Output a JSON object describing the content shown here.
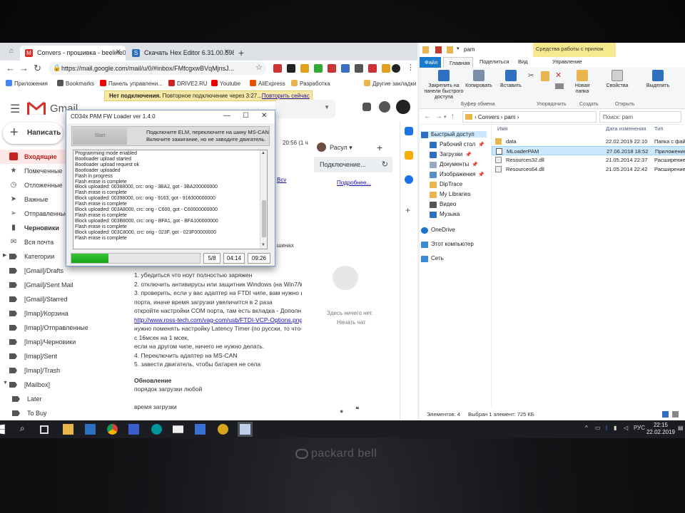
{
  "chrome": {
    "tabs": [
      {
        "title": "Convers - прошивка - beeline09",
        "active": true
      },
      {
        "title": "Скачать Hex Editor 6.31.00.5980",
        "active": false
      }
    ],
    "url": "https://mail.google.com/mail/u/0/#inbox/FMfcgxwBVqMjnsJ...",
    "bookmarks": [
      "Приложения",
      "Bookmarks",
      "Панель управлени...",
      "DRIVE2.RU",
      "Youtube",
      "AliExpress",
      "Разработка",
      "Другие закладки"
    ],
    "banner": {
      "bold": "Нет подключения.",
      "text": " Повторное подключение через 3:27...",
      "link": "Повторить сейчас"
    }
  },
  "gmail": {
    "logo_text": "Gmail",
    "compose": "Написать",
    "sidebar": [
      "Входящие",
      "Помеченные",
      "Отложенные",
      "Важные",
      "Отправленные",
      "Черновики",
      "Вся почта",
      "Категории",
      "[Gmail]/Drafts",
      "[Gmail]/Sent Mail",
      "[Gmail]/Starred",
      "[Imap]/Корзина",
      "[Imap]/Отправленные",
      "[Imap]/Черновики",
      "[Imap]/Sent",
      "[Imap]/Trash",
      "[Mailbox]",
      "Later",
      "To Buy"
    ],
    "fragments": {
      "time": "20:56 (1 ч",
      "link": "Bcv",
      "shinah": "шинах"
    },
    "body": [
      "1. убедиться что ноут полностью заряжен",
      "2. отключить антивирусы или защитник Windows (на Win7/W",
      "3. проверить, если у вас адаптер на FTDI чипе, вам нужно и",
      "порта, иначе время загрузки увеличится в 2 раза",
      "откройте настройки COM порта, там есть вкладка - Дополн",
      "http://www.ross-tech.com/vag-com/usb/FTDI-VCP-Options.png",
      "нужно поменять настройку Latency Timer (по русски, то что-",
      "с 16мсек на 1 мсек,",
      "если на другом чипе, ничего не нужно делать.",
      "4. Переключить адаптер на MS-CAN",
      "5. завести двигатель, чтобы батарея не села"
    ],
    "update_header": "Обновление",
    "update_text": "порядок загрузки любой",
    "load_time": "время загрузки",
    "hangouts": {
      "user": "Расул",
      "connecting": "Подключение...",
      "more": "Подробнее...",
      "empty": "Здесь ничего нет.",
      "start": "Начать чат"
    }
  },
  "loader": {
    "title": "CD34x PAM FW Loader ver 1.4.0",
    "start": "Start",
    "message": [
      "Подключите ELM, переключите на шину MS-CAN",
      "Включите зажигание, но не заводите двигатель."
    ],
    "log": [
      "Programming mode enabled",
      "Bootloader upload started",
      "Bootloader upload request ok",
      "Bootloader uploaded",
      "Flash in progress",
      "Flash erase is complete",
      "Block uploaded: 00388000, crc: orig - 3BA2, got - 3BA200000000",
      "Flash erase is complete",
      "Block uploaded: 00398000, crc: orig - 9163, got - 916300000000",
      "Flash erase is complete",
      "Block uploaded: 003A8000, crc: orig - C600, got - C60000000000",
      "Flash erase is complete",
      "Block uploaded: 003B8000, crc: orig - BFA1, got - BFA100000000",
      "Flash erase is complete",
      "Block uploaded: 003C8000, crc: orig - 023F, got - 023F00000000",
      "Flash erase is complete"
    ],
    "progress": 0.29,
    "blocks": "5/8",
    "elapsed": "04:14",
    "total": "09:26"
  },
  "explorer": {
    "title": "pam",
    "context_tab": "Средства работы с прилож",
    "tabs": [
      "Файл",
      "Главная",
      "Поделиться",
      "Вид",
      "Управление"
    ],
    "ribbon": {
      "pin": "Закрепить на панели быстрого доступа",
      "copy": "Копировать",
      "paste": "Вставить",
      "new_folder": "Новая папка",
      "properties": "Свойства",
      "select": "Выделить",
      "groups": [
        "Буфер обмена",
        "Упорядочить",
        "Создать",
        "Открыть"
      ]
    },
    "path": [
      "Convers",
      "pam"
    ],
    "search_placeholder": "Поиск: pam",
    "tree": [
      "Быстрый доступ",
      "Рабочий стол",
      "Загрузки",
      "Документы",
      "Изображения",
      "DipTrace",
      "My Libraries",
      "Видео",
      "Музыка",
      "OneDrive",
      "Этот компьютер",
      "Сеть"
    ],
    "columns": [
      "Имя",
      "Дата изменения",
      "Тип"
    ],
    "files": [
      {
        "name": "data",
        "date": "22.02.2019 22:10",
        "type": "Папка с файл"
      },
      {
        "name": "MLoaderPAM",
        "date": "27.06.2018 18:52",
        "type": "Приложение"
      },
      {
        "name": "Resources32.dll",
        "date": "21.05.2014 22:37",
        "type": "Расширение"
      },
      {
        "name": "Resources64.dll",
        "date": "21.05.2014 22:42",
        "type": "Расширение"
      }
    ],
    "status_count": "Элементов: 4",
    "status_selected": "Выбран 1 элемент: 725 КБ"
  },
  "taskbar": {
    "lang": "РУС",
    "time": "22:15",
    "date": "22.02.2019"
  },
  "laptop_brand": "packard bell",
  "colors": {
    "gmail_red": "#d93025",
    "progress_green": "#18a818",
    "explorer_blue": "#1979ca"
  }
}
